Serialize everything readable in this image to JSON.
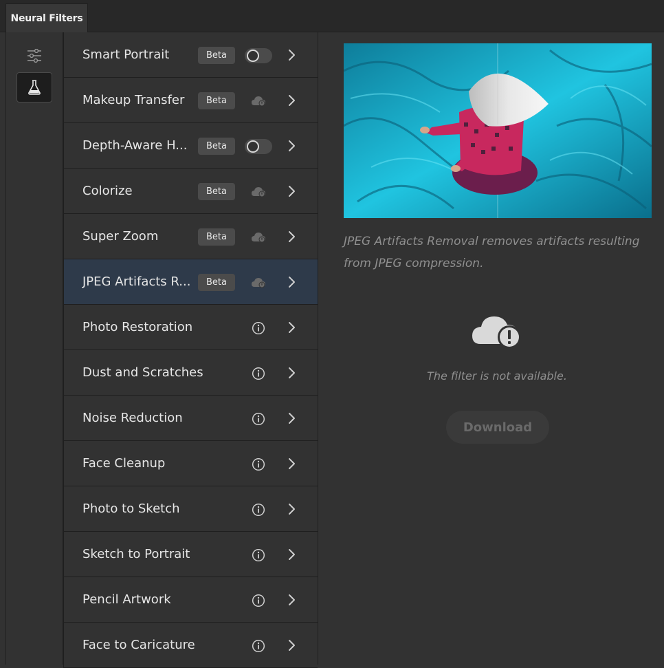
{
  "panel": {
    "tab_title": "Neural Filters"
  },
  "rail": {
    "items": [
      {
        "icon": "sliders-icon",
        "active": false
      },
      {
        "icon": "flask-icon",
        "active": true
      }
    ]
  },
  "filters": [
    {
      "name": "Smart Portrait",
      "badge": "Beta",
      "status": "toggle-off"
    },
    {
      "name": "Makeup Transfer",
      "badge": "Beta",
      "status": "cloud-download"
    },
    {
      "name": "Depth-Aware H...",
      "badge": "Beta",
      "status": "toggle-off"
    },
    {
      "name": "Colorize",
      "badge": "Beta",
      "status": "cloud-download"
    },
    {
      "name": "Super Zoom",
      "badge": "Beta",
      "status": "cloud-download"
    },
    {
      "name": "JPEG Artifacts R...",
      "badge": "Beta",
      "status": "cloud-download",
      "selected": true
    },
    {
      "name": "Photo Restoration",
      "badge": "",
      "status": "info"
    },
    {
      "name": "Dust and Scratches",
      "badge": "",
      "status": "info"
    },
    {
      "name": "Noise Reduction",
      "badge": "",
      "status": "info"
    },
    {
      "name": "Face Cleanup",
      "badge": "",
      "status": "info"
    },
    {
      "name": "Photo to Sketch",
      "badge": "",
      "status": "info"
    },
    {
      "name": "Sketch to Portrait",
      "badge": "",
      "status": "info"
    },
    {
      "name": "Pencil Artwork",
      "badge": "",
      "status": "info"
    },
    {
      "name": "Face to Caricature",
      "badge": "",
      "status": "info"
    }
  ],
  "detail": {
    "description": "JPEG Artifacts Removal removes artifacts resulting from JPEG compression.",
    "unavailable_text": "The filter is not available.",
    "download_label": "Download",
    "status_icon": "cloud-alert-icon"
  },
  "colors": {
    "panel_bg": "#323232",
    "selected_row": "#2e3a4a",
    "preview_water": "#1aa9c8"
  }
}
